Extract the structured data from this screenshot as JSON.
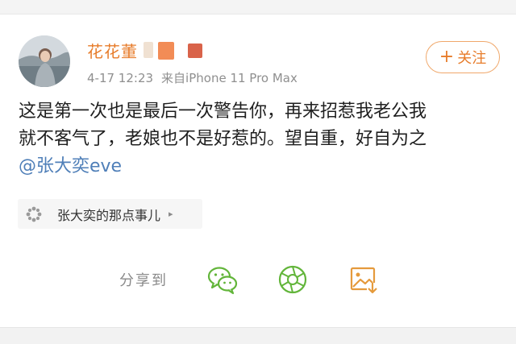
{
  "post": {
    "author": "花花董",
    "time": "4-17 12:23",
    "source": "来自iPhone 11 Pro Max",
    "follow_label": "关注",
    "lines": [
      "这是第一次也是最后一次警告你，再来招惹我老公我",
      "就不客气了，老娘也不是好惹的。望自重，好自为之"
    ],
    "mention": "@张大奕eve"
  },
  "topic": {
    "label": "张大奕的那点事儿",
    "arrow": "▸",
    "icon": "pinwheel-icon"
  },
  "share": {
    "label": "分享到",
    "targets": [
      {
        "name": "wechat",
        "icon": "wechat-icon",
        "color": "#62b53a"
      },
      {
        "name": "moments",
        "icon": "moments-icon",
        "color": "#62b53a"
      },
      {
        "name": "save-image",
        "icon": "image-download-icon",
        "color": "#e59a3c"
      }
    ]
  },
  "colors": {
    "accent": "#e77c2b",
    "mention": "#4f7fb8",
    "secondary_text": "#8f8f8f"
  }
}
